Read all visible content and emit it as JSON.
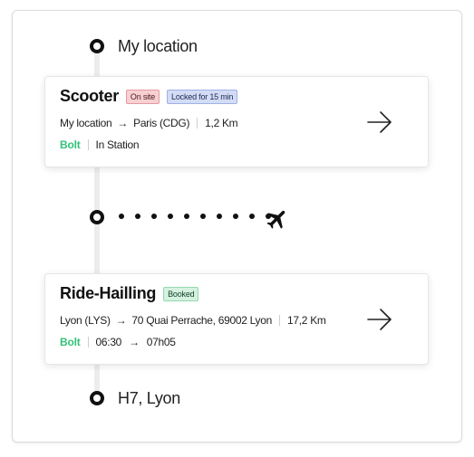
{
  "stops": {
    "origin_label": "My location",
    "destination_label": "H7, Lyon"
  },
  "flight": {
    "icon": "airplane-icon"
  },
  "cards": [
    {
      "title": "Scooter",
      "badges": [
        "On site",
        "Locked for 15 min"
      ],
      "route_from": "My location",
      "route_to": "Paris (CDG)",
      "distance": "1,2 Km",
      "provider": "Bolt",
      "status": "In Station"
    },
    {
      "title": "Ride-Hailling",
      "badges": [
        "Booked"
      ],
      "route_from": "Lyon (LYS)",
      "route_to": "70 Quai Perrache, 69002 Lyon",
      "distance": "17,2 Km",
      "provider": "Bolt",
      "depart_time": "06:30",
      "arrive_time": "07h05"
    }
  ],
  "colors": {
    "brand_green": "#34c27a",
    "badge_red": "#f8d0d2",
    "badge_blue": "#d3dcf5",
    "badge_green": "#d5f1df"
  }
}
